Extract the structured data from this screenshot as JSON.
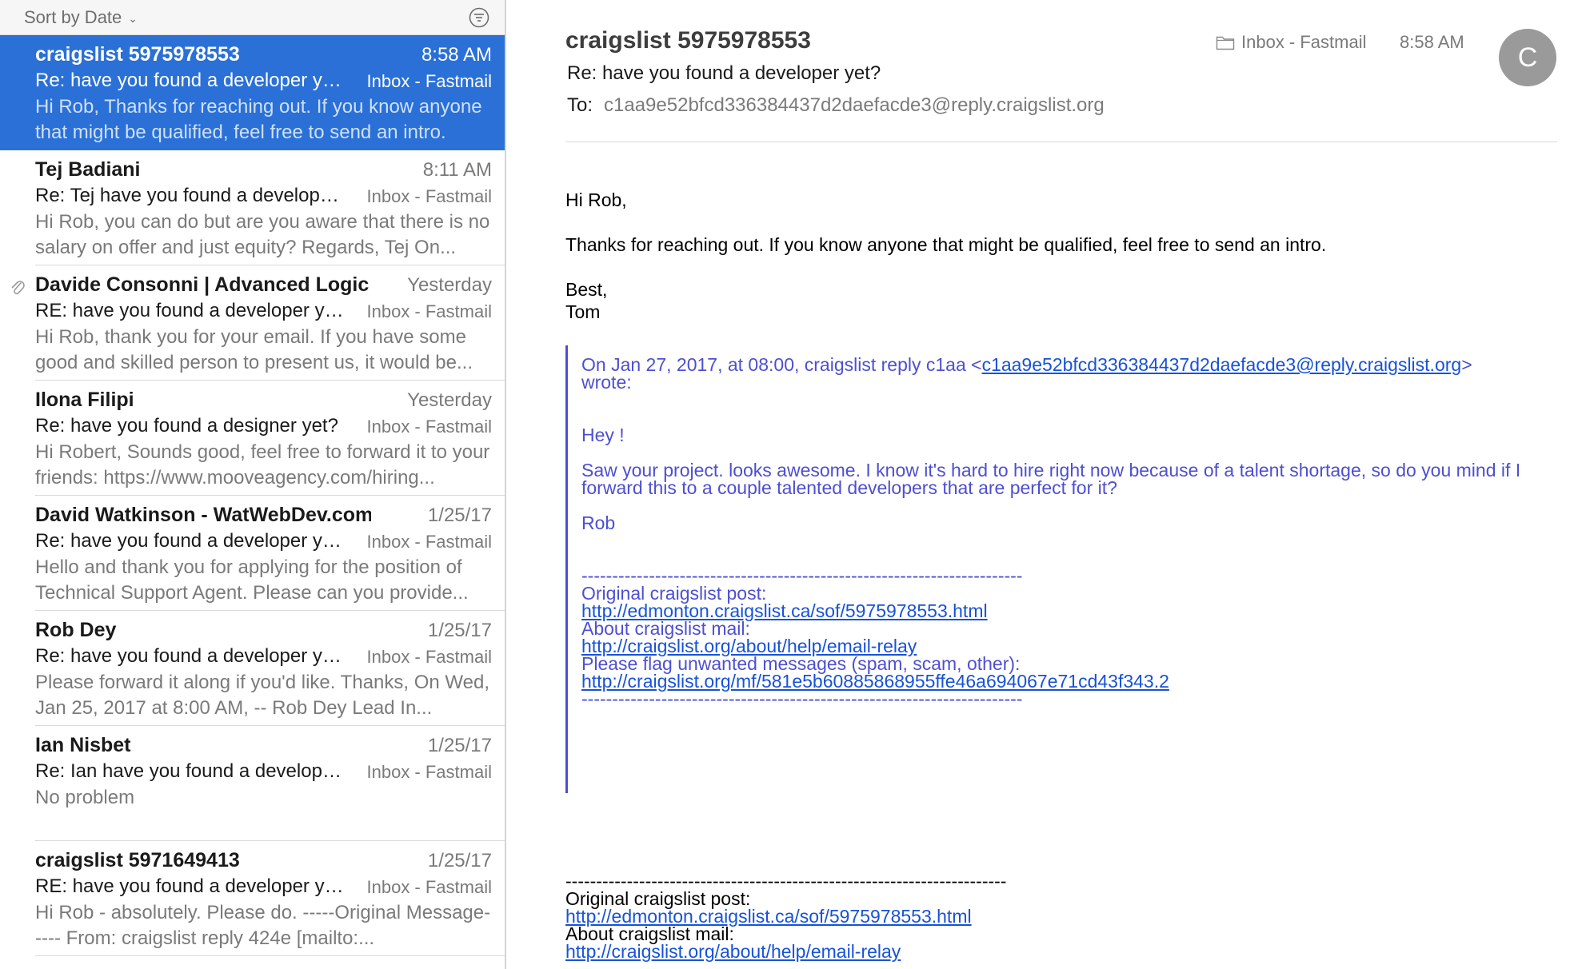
{
  "list": {
    "sort_label": "Sort by Date",
    "messages": [
      {
        "sender": "craigslist 5975978553",
        "time": "8:58 AM",
        "subject": "Re: have you found a developer yet?",
        "mailbox": "Inbox - Fastmail",
        "preview": "Hi Rob, Thanks for reaching out. If you know anyone that might be qualified, feel free to send an intro.",
        "selected": true,
        "attachment": false
      },
      {
        "sender": "Tej Badiani",
        "time": "8:11 AM",
        "subject": "Re: Tej have you found a developer yet?",
        "mailbox": "Inbox - Fastmail",
        "preview": "Hi Rob,  you can do but are you aware that there is no salary on offer and just equity? Regards, Tej On...",
        "selected": false,
        "attachment": false
      },
      {
        "sender": "Davide Consonni | Advanced Logic",
        "time": "Yesterday",
        "subject": "RE: have you found a developer yet?",
        "mailbox": "Inbox - Fastmail",
        "preview": "Hi Rob, thank you for your email. If you have some good and skilled person to present us, it would be...",
        "selected": false,
        "attachment": true
      },
      {
        "sender": "Ilona Filipi",
        "time": "Yesterday",
        "subject": "Re: have you found a designer yet?",
        "mailbox": "Inbox - Fastmail",
        "preview": "Hi Robert, Sounds good, feel free to forward it to your friends: https://www.mooveagency.com/hiring...",
        "selected": false,
        "attachment": false
      },
      {
        "sender": "David Watkinson - WatWebDev.com",
        "time": "1/25/17",
        "subject": "Re: have you found a developer yet?",
        "mailbox": "Inbox - Fastmail",
        "preview": "Hello and thank you for applying for the position of Technical Support Agent. Please can you provide...",
        "selected": false,
        "attachment": false
      },
      {
        "sender": "Rob Dey",
        "time": "1/25/17",
        "subject": "Re: have you found a developer yet?",
        "mailbox": "Inbox - Fastmail",
        "preview": "Please forward it along if you'd like. Thanks, On Wed, Jan 25, 2017 at 8:00 AM, -- Rob Dey Lead In...",
        "selected": false,
        "attachment": false
      },
      {
        "sender": "Ian Nisbet",
        "time": "1/25/17",
        "subject": "Re: Ian have you found a developer yet?",
        "mailbox": "Inbox - Fastmail",
        "preview": "No problem",
        "selected": false,
        "attachment": false
      },
      {
        "sender": "craigslist 5971649413",
        "time": "1/25/17",
        "subject": "RE: have you found a developer yet?",
        "mailbox": "Inbox - Fastmail",
        "preview": "Hi Rob - absolutely. Please do. -----Original Message----- From: craigslist reply 424e [mailto:...",
        "selected": false,
        "attachment": false
      }
    ]
  },
  "message": {
    "from": "craigslist 5975978553",
    "mailbox": "Inbox - Fastmail",
    "time": "8:58 AM",
    "avatar_initial": "C",
    "subject": "Re: have you found a developer yet?",
    "to_label": "To:",
    "to_address": "c1aa9e52bfcd336384437d2daefacde3@reply.craigslist.org",
    "greeting": "Hi Rob,",
    "body": "Thanks for reaching out.  If you know anyone that might be qualified, feel free to send an intro.",
    "signoff": "Best,",
    "signature": "Tom",
    "quote": {
      "attribution_prefix": "On Jan 27, 2017, at 08:00, craigslist reply c1aa <",
      "attribution_email": "c1aa9e52bfcd336384437d2daefacde3@reply.craigslist.org",
      "attribution_suffix": ">",
      "wrote": "wrote:",
      "hey": "Hey !",
      "para1_line1": "Saw your project. looks awesome. I know it's hard to hire right now because of a talent shortage, so do you mind if I",
      "para1_line2": "forward this to a couple talented developers that are perfect for it?",
      "sign": "Rob",
      "dashes": "------------------------------------------------------------------------",
      "orig_label": "Original craigslist post:",
      "orig_link": "http://edmonton.craigslist.ca/sof/5975978553.html",
      "about_label": "About craigslist mail:",
      "about_link": "http://craigslist.org/about/help/email-relay",
      "flag_label": "Please flag unwanted messages (spam, scam, other):",
      "flag_link": "http://craigslist.org/mf/581e5b60885868955ffe46a694067e71cd43f343.2"
    },
    "footer": {
      "dashes": "------------------------------------------------------------------------",
      "orig_label": "Original craigslist post:",
      "orig_link": "http://edmonton.craigslist.ca/sof/5975978553.html",
      "about_label": "About craigslist mail:",
      "about_link": "http://craigslist.org/about/help/email-relay"
    }
  },
  "colors": {
    "selection": "#2a70d6",
    "quote": "#4e4fd1",
    "link": "#1752d9"
  }
}
